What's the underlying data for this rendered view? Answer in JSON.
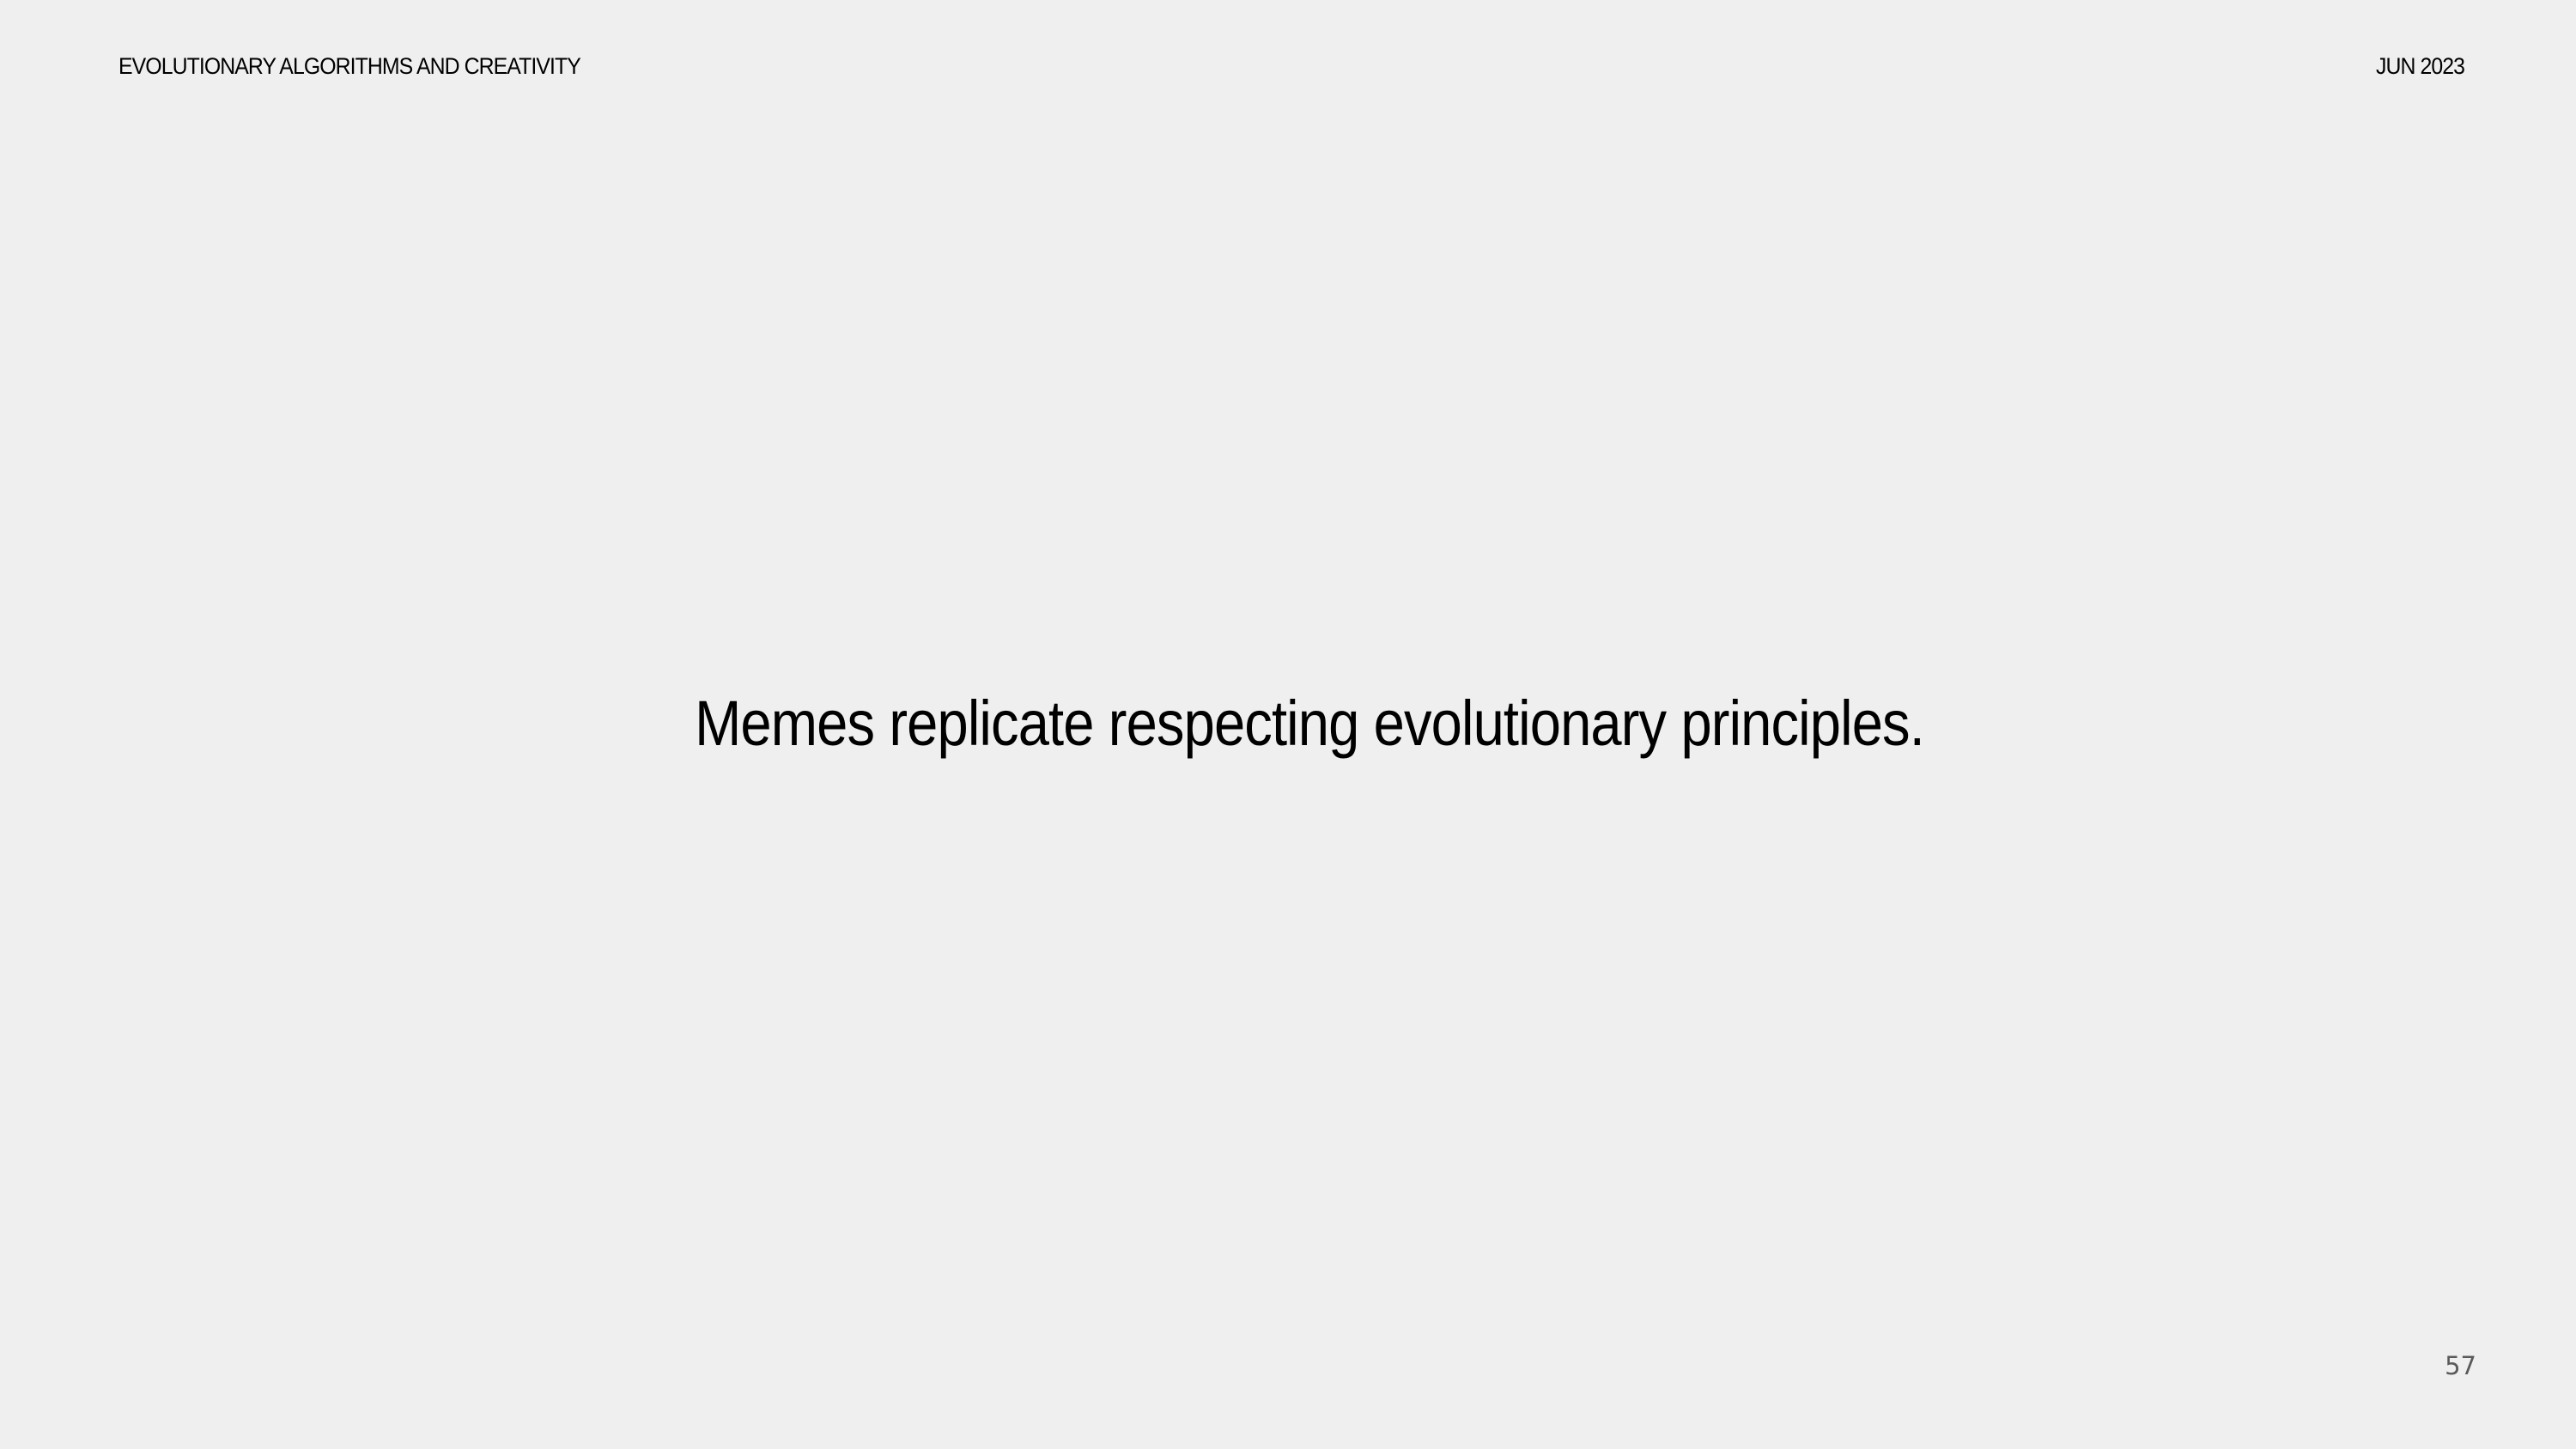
{
  "header": {
    "title": "EVOLUTIONARY ALGORITHMS AND CREATIVITY",
    "date": "JUN 2023"
  },
  "body": {
    "statement": "Memes replicate respecting evolutionary principles."
  },
  "footer": {
    "page_number": "57"
  },
  "colors": {
    "background": "#efefef",
    "text": "#000000",
    "page_number": "#5a5a5a"
  }
}
